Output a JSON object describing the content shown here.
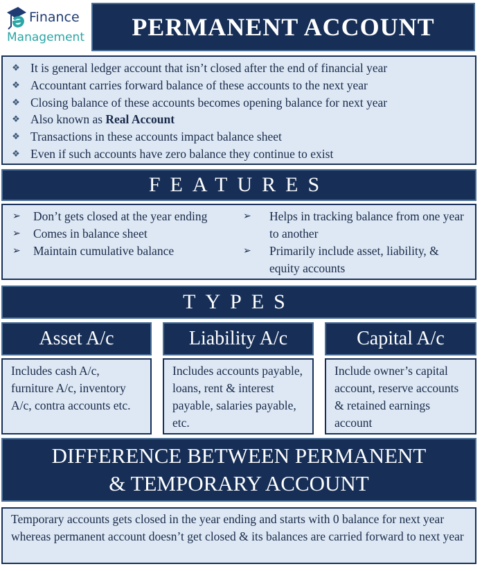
{
  "logo": {
    "line1": "Finance",
    "line2": "Management",
    "icon": "graduation-cap-e-icon",
    "colors": {
      "primary": "#1f3b73",
      "accent": "#2aa6a6"
    }
  },
  "title": "PERMANENT ACCOUNT",
  "intro": {
    "bullet_icon": "diamond-bullet-icon",
    "items": [
      {
        "text": "It is general ledger account that isn’t closed after the end of financial year"
      },
      {
        "text": "Accountant carries forward balance of these accounts to the next year"
      },
      {
        "text": "Closing balance of these accounts becomes opening balance for next year"
      },
      {
        "text": "Also known as ",
        "bold": "Real Account"
      },
      {
        "text": "Transactions in these accounts impact balance sheet"
      },
      {
        "text": "Even if such accounts have zero balance they continue to exist"
      }
    ]
  },
  "features": {
    "heading": "FEATURES",
    "bullet_icon": "arrow-bullet-icon",
    "left": [
      "Don’t gets closed at the year ending",
      "Comes in balance sheet",
      "Maintain cumulative balance"
    ],
    "right": [
      "Helps in tracking balance from one year to another",
      "Primarily include asset, liability, & equity accounts"
    ]
  },
  "types": {
    "heading": "TYPES",
    "items": [
      {
        "title": "Asset A/c",
        "description": "Includes cash A/c, furniture A/c, inventory A/c, contra accounts etc."
      },
      {
        "title": "Liability A/c",
        "description": "Includes accounts payable, loans, rent & interest payable, salaries payable, etc."
      },
      {
        "title": "Capital A/c",
        "description": "Include owner’s capital account, reserve accounts & retained earnings account"
      }
    ]
  },
  "difference": {
    "heading": "DIFFERENCE BETWEEN PERMANENT & TEMPORARY ACCOUNT",
    "text": "Temporary accounts gets closed in the year ending and starts with 0 balance for next year whereas permanent account doesn’t get closed & its balances are carried forward to next year"
  },
  "colors": {
    "dark_band": "#172f57",
    "band_border": "#4a6e96",
    "light_box": "#dde8f4"
  }
}
